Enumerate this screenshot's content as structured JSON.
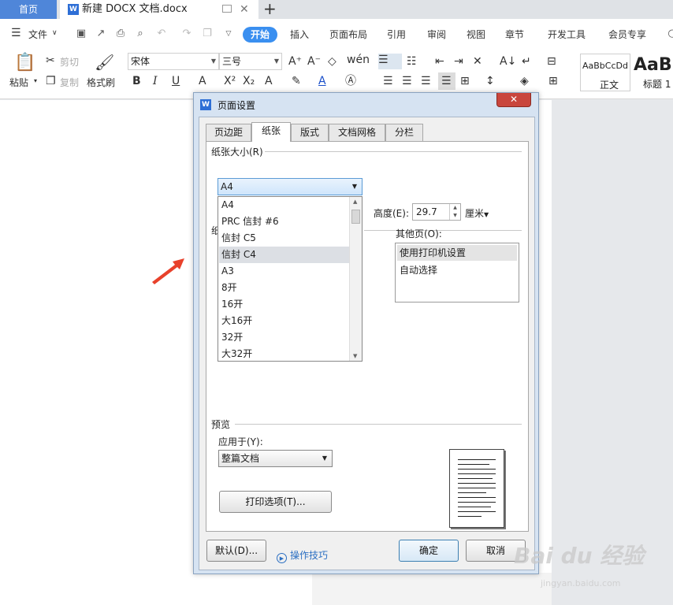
{
  "tabbar": {
    "home": "首页",
    "doc_title": "新建 DOCX 文档.docx",
    "new_tab": "+",
    "close": "✕"
  },
  "menu": {
    "file": "文件",
    "start": "开始",
    "items": [
      "插入",
      "页面布局",
      "引用",
      "审阅",
      "视图",
      "章节",
      "开发工具",
      "会员专享"
    ]
  },
  "ribbon": {
    "paste": "粘贴",
    "cut": "剪切",
    "copy": "复制",
    "format_painter": "格式刷",
    "font_name": "宋体",
    "font_size": "三号",
    "style_normal_preview": "AaBbCcDd",
    "style_normal": "正文",
    "style_heading_preview": "AaBl",
    "style_heading": "标题 1"
  },
  "dialog": {
    "title": "页面设置",
    "tabs": [
      "页边距",
      "纸张",
      "版式",
      "文档网格",
      "分栏"
    ],
    "active_tab": "纸张",
    "paper_size_label": "纸张大小(R)",
    "paper_size_value": "A4",
    "paper_options": [
      "A4",
      "PRC 信封 #6",
      "信封 C5",
      "信封 C4",
      "A3",
      "8开",
      "16开",
      "大16开",
      "32开",
      "大32开"
    ],
    "highlighted_option": "信封 C4",
    "height_label": "高度(E):",
    "height_value": "29.7",
    "unit": "厘米",
    "hidden_group_char": "纸",
    "other_pages_label": "其他页(O):",
    "other_pages_options": [
      "使用打印机设置",
      "自动选择"
    ],
    "preview_label": "预览",
    "apply_to_label": "应用于(Y):",
    "apply_to_value": "整篇文档",
    "print_options": "打印选项(T)...",
    "default_button": "默认(D)...",
    "tips": "操作技巧",
    "ok": "确定",
    "cancel": "取消"
  },
  "watermark": {
    "brand": "Bai du 经验",
    "url": "jingyan.baidu.com"
  },
  "colors": {
    "accent": "#3a8ff0",
    "home_tab": "#4f86d9",
    "arrow": "#e8412b",
    "close": "#c9463d"
  }
}
